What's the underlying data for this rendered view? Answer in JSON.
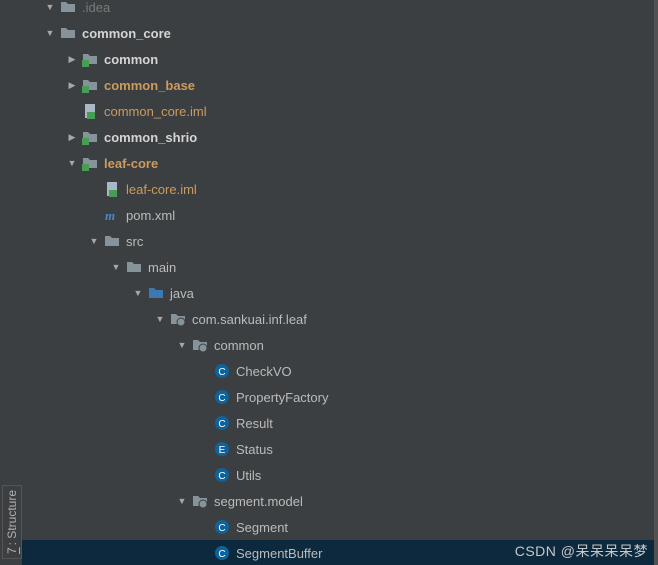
{
  "sidebar_tab": {
    "num": "7",
    "label": "Structure"
  },
  "watermark": "CSDN @呆呆呆呆梦",
  "arrow": {
    "down": "▼",
    "right": "▶"
  },
  "rows": [
    {
      "indent": 1,
      "arrow": "down",
      "icon": "folder",
      "label": ".idea",
      "style": "dim"
    },
    {
      "indent": 1,
      "arrow": "down",
      "icon": "folder",
      "label": "common_core",
      "style": "bold"
    },
    {
      "indent": 2,
      "arrow": "right",
      "icon": "module",
      "label": "common",
      "style": "bold"
    },
    {
      "indent": 2,
      "arrow": "right",
      "icon": "module",
      "label": "common_base",
      "style": "highlight-bold"
    },
    {
      "indent": 2,
      "arrow": "",
      "icon": "iml",
      "label": "common_core.iml",
      "style": "highlight"
    },
    {
      "indent": 2,
      "arrow": "right",
      "icon": "module",
      "label": "common_shrio",
      "style": "bold"
    },
    {
      "indent": 2,
      "arrow": "down",
      "icon": "module",
      "label": "leaf-core",
      "style": "highlight-bold"
    },
    {
      "indent": 3,
      "arrow": "",
      "icon": "iml",
      "label": "leaf-core.iml",
      "style": "highlight"
    },
    {
      "indent": 3,
      "arrow": "",
      "icon": "pom",
      "label": "pom.xml",
      "style": ""
    },
    {
      "indent": 3,
      "arrow": "down",
      "icon": "folder",
      "label": "src",
      "style": ""
    },
    {
      "indent": 4,
      "arrow": "down",
      "icon": "folder",
      "label": "main",
      "style": ""
    },
    {
      "indent": 5,
      "arrow": "down",
      "icon": "src-folder",
      "label": "java",
      "style": ""
    },
    {
      "indent": 6,
      "arrow": "down",
      "icon": "package",
      "label": "com.sankuai.inf.leaf",
      "style": ""
    },
    {
      "indent": 7,
      "arrow": "down",
      "icon": "package",
      "label": "common",
      "style": ""
    },
    {
      "indent": 8,
      "arrow": "",
      "icon": "class",
      "label": "CheckVO",
      "style": ""
    },
    {
      "indent": 8,
      "arrow": "",
      "icon": "class",
      "label": "PropertyFactory",
      "style": ""
    },
    {
      "indent": 8,
      "arrow": "",
      "icon": "class",
      "label": "Result",
      "style": ""
    },
    {
      "indent": 8,
      "arrow": "",
      "icon": "enum",
      "label": "Status",
      "style": ""
    },
    {
      "indent": 8,
      "arrow": "",
      "icon": "class",
      "label": "Utils",
      "style": ""
    },
    {
      "indent": 7,
      "arrow": "down",
      "icon": "package",
      "label": "segment.model",
      "style": ""
    },
    {
      "indent": 8,
      "arrow": "",
      "icon": "class",
      "label": "Segment",
      "style": ""
    },
    {
      "indent": 8,
      "arrow": "",
      "icon": "class",
      "label": "SegmentBuffer",
      "style": "",
      "selected": true
    }
  ]
}
